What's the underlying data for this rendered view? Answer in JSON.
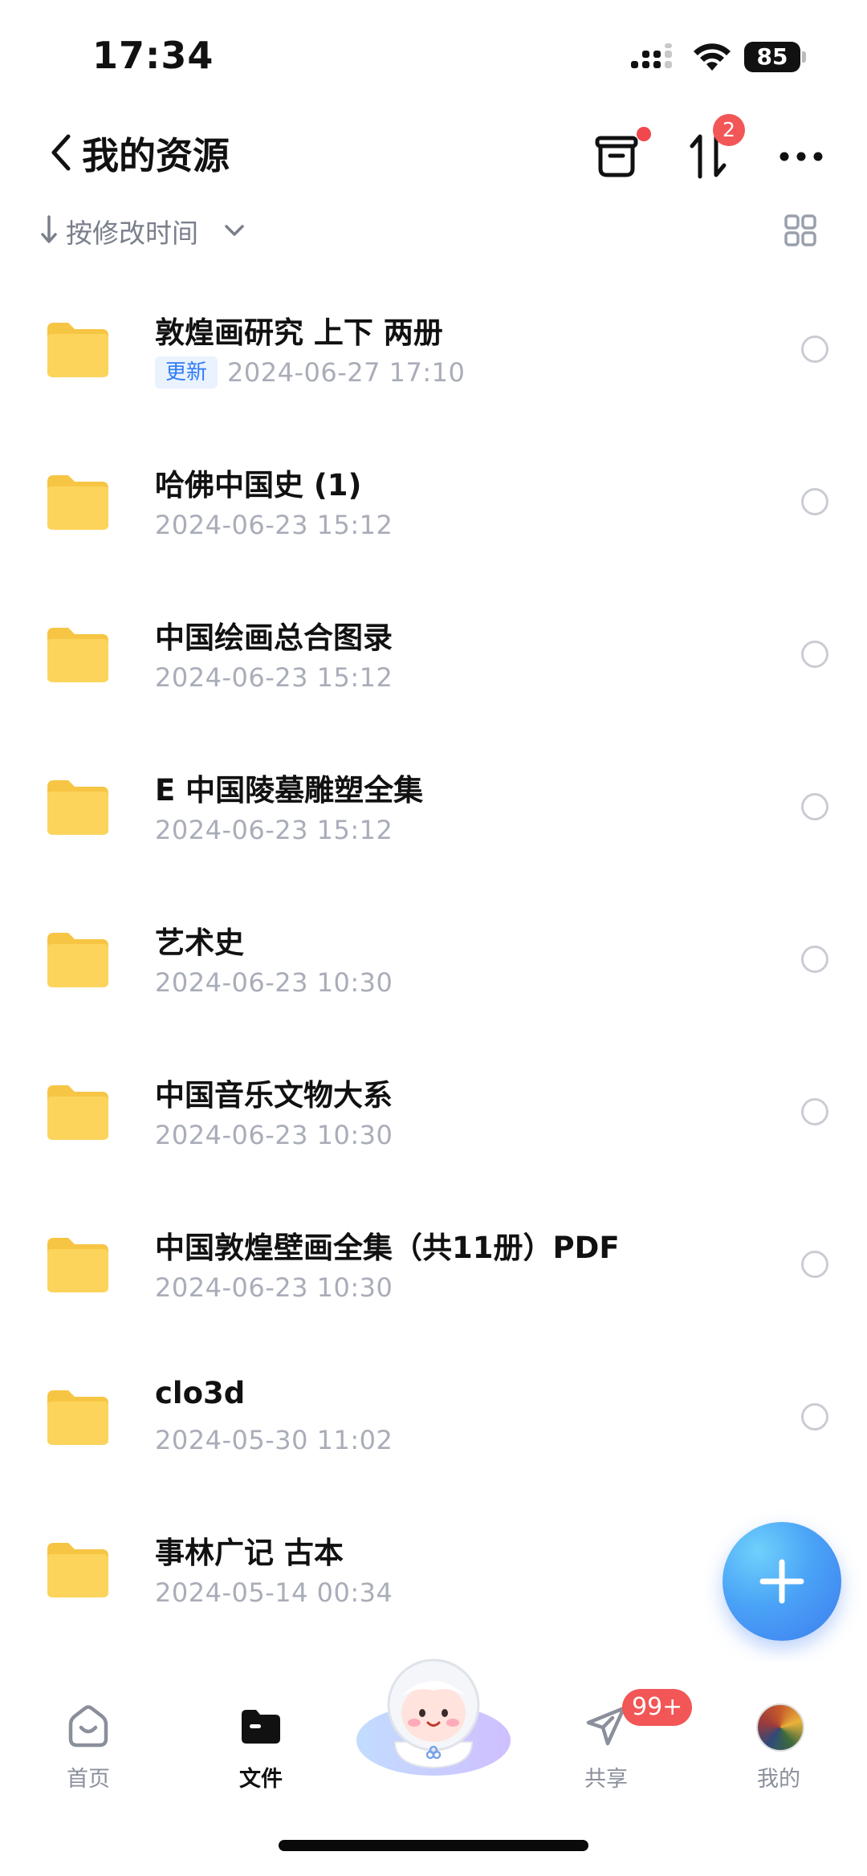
{
  "status_bar": {
    "time": "17:34",
    "battery": "85"
  },
  "header": {
    "title": "我的资源",
    "transfer_badge": "2"
  },
  "sort": {
    "label": "按修改时间"
  },
  "files": [
    {
      "name": "敦煌画研究 上下  两册",
      "tag": "更新",
      "date": "2024-06-27 17:10"
    },
    {
      "name": "哈佛中国史 (1)",
      "tag": "",
      "date": "2024-06-23 15:12"
    },
    {
      "name": "中国绘画总合图录",
      "tag": "",
      "date": "2024-06-23 15:12"
    },
    {
      "name": "E 中国陵墓雕塑全集",
      "tag": "",
      "date": "2024-06-23 15:12"
    },
    {
      "name": "艺术史",
      "tag": "",
      "date": "2024-06-23 10:30"
    },
    {
      "name": "中国音乐文物大系",
      "tag": "",
      "date": "2024-06-23 10:30"
    },
    {
      "name": "中国敦煌壁画全集（共11册）PDF",
      "tag": "",
      "date": "2024-06-23 10:30"
    },
    {
      "name": "clo3d",
      "tag": "",
      "date": "2024-05-30 11:02"
    },
    {
      "name": "事林广记 古本",
      "tag": "",
      "date": "2024-05-14 00:34"
    }
  ],
  "nav": {
    "home": "首页",
    "files": "文件",
    "share": "共享",
    "share_badge": "99+",
    "mine": "我的"
  },
  "colors": {
    "accent": "#3d7cf0",
    "badge": "#f25656",
    "folder": "#fcd45c",
    "tag_bg": "#eaf2fe",
    "tag_text": "#2f7cf6"
  }
}
